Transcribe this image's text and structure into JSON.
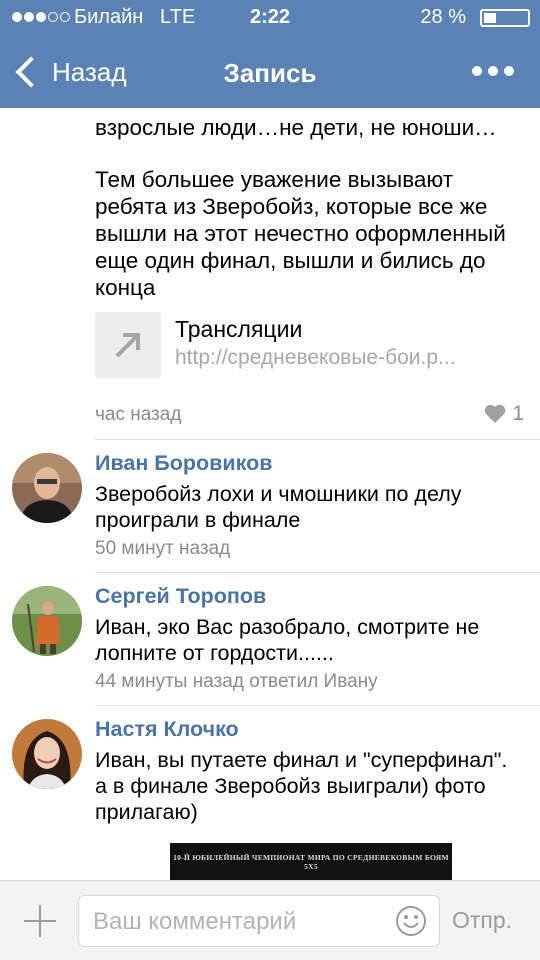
{
  "status_bar": {
    "carrier": "Билайн",
    "network": "LTE",
    "time": "2:22",
    "battery_percent": "28 %",
    "battery_level": 0.28,
    "signal_bars": 3
  },
  "nav": {
    "back_label": "Назад",
    "title": "Запись",
    "more_icon": "more-dots-icon"
  },
  "post": {
    "text_line_top": "взрослые люди…не дети, не юноши…",
    "paragraph": "Тем большее уважение вызывают ребята из Зверобойз, которые все же вышли на этот нечестно оформленный еще один финал, вышли и бились до конца",
    "link": {
      "title": "Трансляции",
      "url": "http://средневековые-бои.р...",
      "icon": "arrow-up-right-icon"
    },
    "time": "час назад",
    "likes": "1"
  },
  "comments": [
    {
      "name": "Иван Боровиков",
      "text": "Зверобойз лохи и чмошники по делу проиграли в финале",
      "meta": "50 минут назад"
    },
    {
      "name": "Сергей Торопов",
      "text": "Иван, эко Вас разобрало, смотрите не лопните от гордости......",
      "meta": "44 минуты назад ответил Ивану"
    },
    {
      "name": "Настя Клочко",
      "text": "Иван, вы путаете финал и \"суперфинал\". а в финале Зверобойз выиграли) фото прилагаю)",
      "meta": ""
    }
  ],
  "attachment_photo": {
    "caption": "10-Й ЮБИЛЕЙНЫЙ ЧЕМПИОНАТ МИРА ПО СРЕДНЕВЕКОВЫМ БОЯМ 5X5"
  },
  "composer": {
    "placeholder": "Ваш комментарий",
    "send_label": "Отпр."
  },
  "colors": {
    "header": "#5b82b4",
    "name_link": "#4a74a5",
    "meta": "#8a8a8a"
  }
}
